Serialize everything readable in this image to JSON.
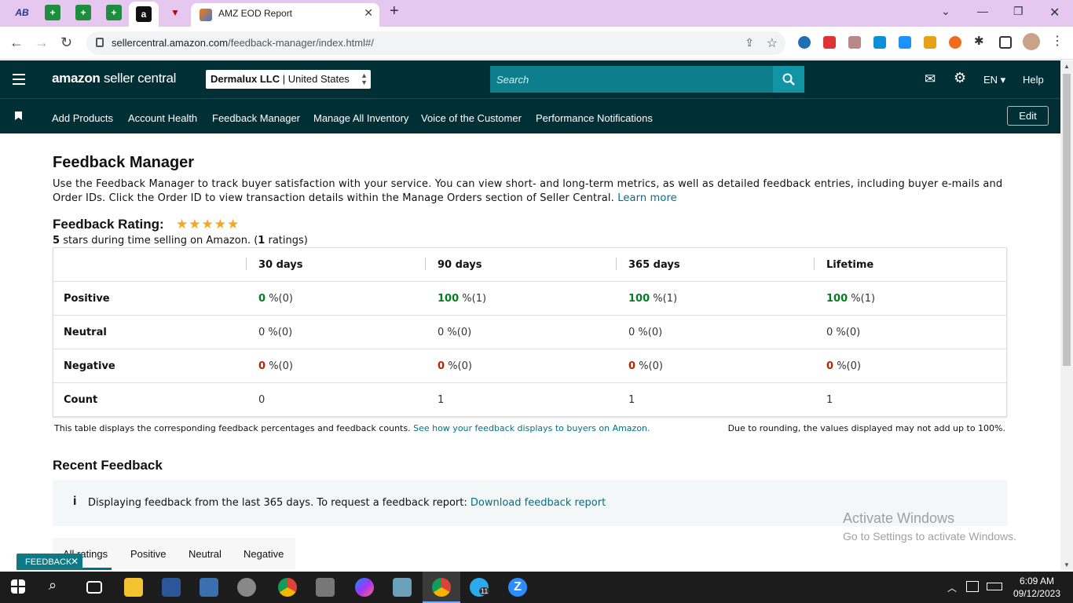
{
  "browser": {
    "pinned_tabs": [
      "AB",
      "+",
      "+",
      "+",
      "a",
      "▼"
    ],
    "active_tab": {
      "title": "AMZ EOD Report"
    },
    "url_domain": "sellercentral.amazon.com",
    "url_path": "/feedback-manager/index.html#/"
  },
  "header": {
    "logo_brand": "amazon",
    "logo_text": "seller central",
    "account_name": "Dermalux LLC",
    "account_region": "United States",
    "search_placeholder": "Search",
    "language": "EN",
    "help_label": "Help"
  },
  "nav": {
    "items": [
      "Add Products",
      "Account Health",
      "Feedback Manager",
      "Manage All Inventory",
      "Voice of the Customer",
      "Performance Notifications"
    ],
    "edit_label": "Edit"
  },
  "page": {
    "title": "Feedback Manager",
    "description": "Use the Feedback Manager to track buyer satisfaction with your service. You can view short- and long-term metrics, as well as detailed feedback entries, including buyer e-mails and Order IDs. Click the Order ID to view transaction details within the Manage Orders section of Seller Central.",
    "learn_more": "Learn more",
    "rating_heading": "Feedback Rating:",
    "stars": "★★★★★",
    "rating_value": "5",
    "rating_text_mid": "stars during time selling on Amazon. (",
    "rating_count": "1",
    "rating_text_end": "ratings)"
  },
  "table": {
    "columns": [
      "30 days",
      "90 days",
      "365 days",
      "Lifetime"
    ],
    "rows": [
      {
        "label": "Positive",
        "cells": [
          {
            "v": "0",
            "s": "%(0)"
          },
          {
            "v": "100",
            "s": "%(1)"
          },
          {
            "v": "100",
            "s": "%(1)"
          },
          {
            "v": "100",
            "s": "%(1)"
          }
        ]
      },
      {
        "label": "Neutral",
        "cells": [
          {
            "v": "0",
            "s": "%(0)"
          },
          {
            "v": "0",
            "s": "%(0)"
          },
          {
            "v": "0",
            "s": "%(0)"
          },
          {
            "v": "0",
            "s": "%(0)"
          }
        ]
      },
      {
        "label": "Negative",
        "cells": [
          {
            "v": "0",
            "s": "%(0)"
          },
          {
            "v": "0",
            "s": "%(0)"
          },
          {
            "v": "0",
            "s": "%(0)"
          },
          {
            "v": "0",
            "s": "%(0)"
          }
        ]
      },
      {
        "label": "Count",
        "cells": [
          {
            "v": "0",
            "s": ""
          },
          {
            "v": "1",
            "s": ""
          },
          {
            "v": "1",
            "s": ""
          },
          {
            "v": "1",
            "s": ""
          }
        ]
      }
    ],
    "note": "This table displays the corresponding feedback percentages and feedback counts.",
    "note_link": "See how your feedback displays to buyers on Amazon.",
    "rounding_note": "Due to rounding, the values displayed may not add up to 100%."
  },
  "recent": {
    "heading": "Recent Feedback",
    "info_text": "Displaying feedback from the last 365 days. To request a feedback report:",
    "info_link": "Download feedback report",
    "tabs": [
      "All ratings",
      "Positive",
      "Neutral",
      "Negative"
    ]
  },
  "overlay": {
    "feedback_badge": "FEEDBACK",
    "watermark_title": "Activate Windows",
    "watermark_sub": "Go to Settings to activate Windows."
  },
  "taskbar": {
    "time": "6:09 AM",
    "date": "09/12/2023",
    "badge": "11"
  },
  "colors": {
    "header_bg": "#002f36",
    "search_bg": "#0d7f8c",
    "link": "#007185",
    "positive": "#067d22",
    "negative": "#b12704",
    "tab_strip": "#e6c7f0"
  }
}
